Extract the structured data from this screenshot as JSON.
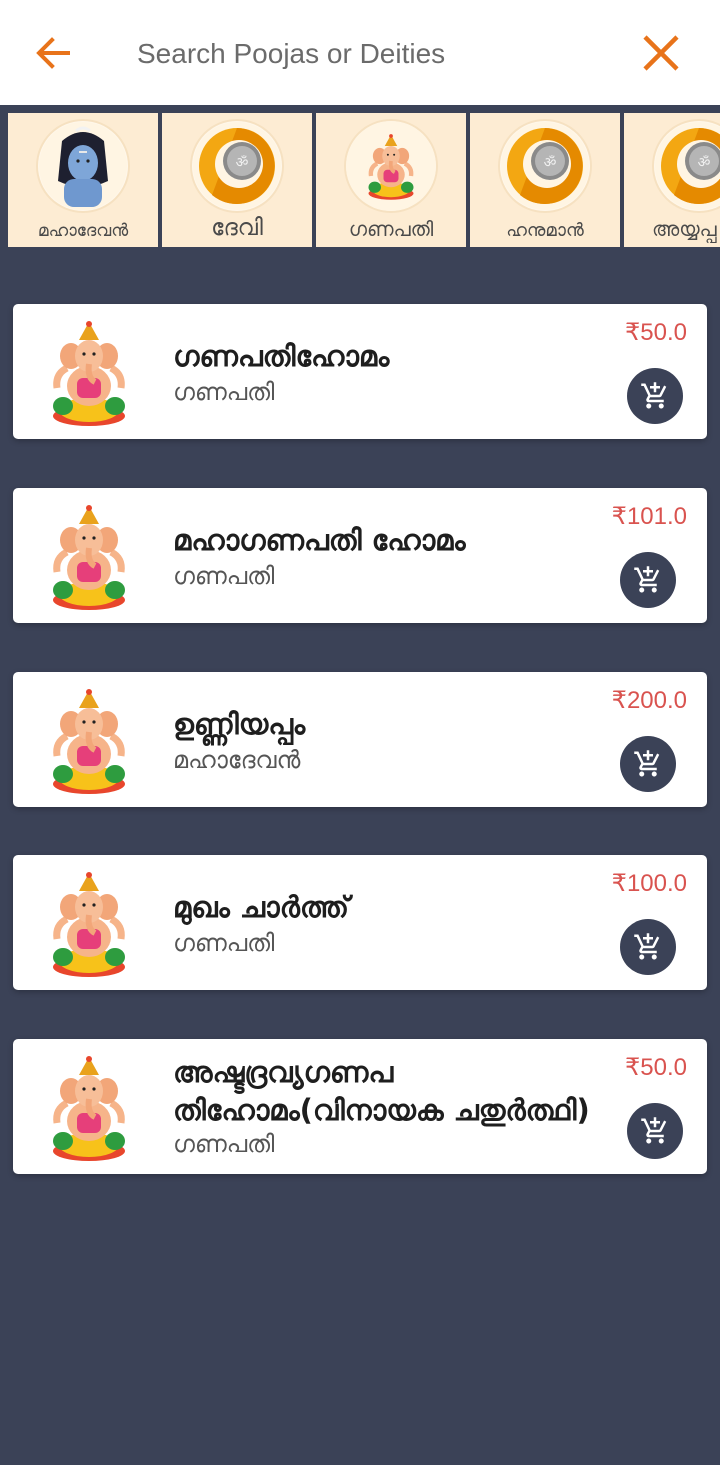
{
  "search": {
    "placeholder": "Search Poojas or Deities"
  },
  "colors": {
    "accent": "#e8731a",
    "background": "#3b4257",
    "price": "#d9534f",
    "card_bg": "#fdecd3"
  },
  "deities": [
    {
      "name": "മഹാദേവൻ",
      "icon": "shiva-image"
    },
    {
      "name": "ദേവി",
      "icon": "coin-logo-image"
    },
    {
      "name": "ഗണപതി",
      "icon": "ganapathi-image"
    },
    {
      "name": "ഹനുമാൻ",
      "icon": "coin-logo-image"
    },
    {
      "name": "അയ്യപ്പ",
      "icon": "coin-logo-image"
    }
  ],
  "poojas": [
    {
      "title": "ഗണപതിഹോമം",
      "deity": "ഗണപതി",
      "price": "₹50.0"
    },
    {
      "title": "മഹാഗണപതി ഹോമം",
      "deity": "ഗണപതി",
      "price": "₹101.0"
    },
    {
      "title": "ഉണ്ണിയപ്പം",
      "deity": "മഹാദേവൻ",
      "price": "₹200.0"
    },
    {
      "title": "മുഖം ചാർത്ത്",
      "deity": "ഗണപതി",
      "price": "₹100.0"
    },
    {
      "title": "അഷ്ടദ്രവ്യഗണപതിഹോമം(വിനായക ചതുർത്ഥി)",
      "deity": "ഗണപതി",
      "price": "₹50.0"
    }
  ]
}
